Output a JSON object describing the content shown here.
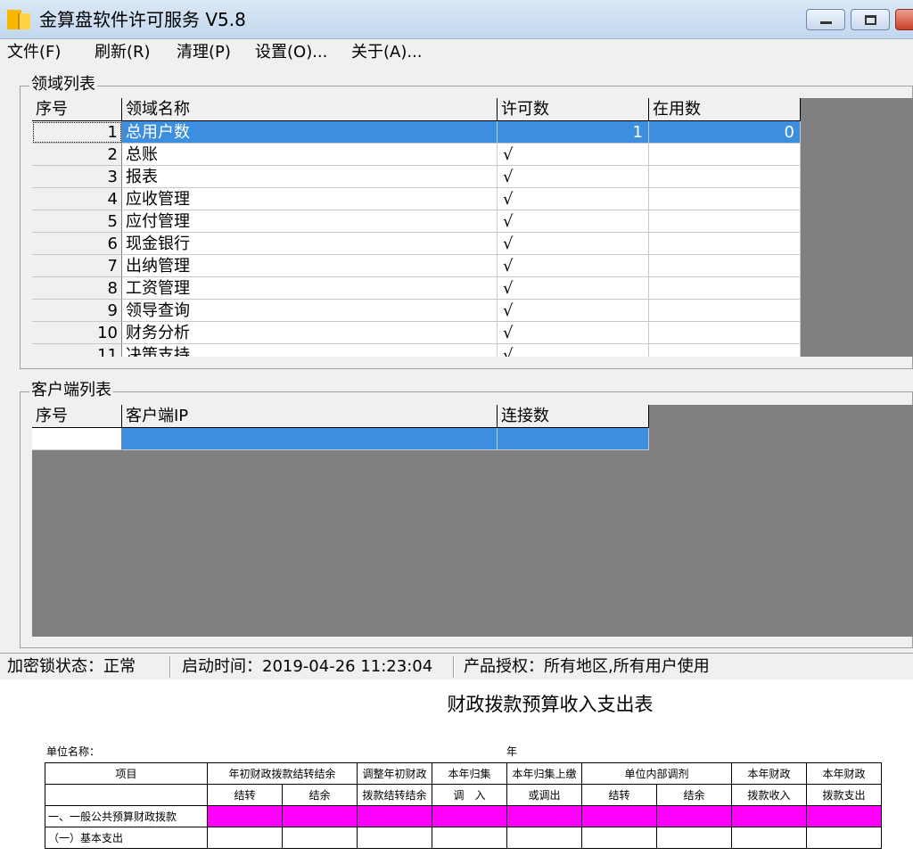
{
  "window": {
    "title": "金算盘软件许可服务 V5.8",
    "icon": "app-logo-icon"
  },
  "menu": [
    "文件(F)",
    "刷新(R)",
    "清理(P)",
    "设置(O)...",
    "关于(A)..."
  ],
  "domain_list": {
    "group_title": "领域列表",
    "headers": [
      "序号",
      "领域名称",
      "许可数",
      "在用数"
    ],
    "rows": [
      {
        "no": "1",
        "name": "总用户数",
        "license": "1",
        "in_use": "0"
      },
      {
        "no": "2",
        "name": "总账",
        "license": "√",
        "in_use": ""
      },
      {
        "no": "3",
        "name": "报表",
        "license": "√",
        "in_use": ""
      },
      {
        "no": "4",
        "name": "应收管理",
        "license": "√",
        "in_use": ""
      },
      {
        "no": "5",
        "name": "应付管理",
        "license": "√",
        "in_use": ""
      },
      {
        "no": "6",
        "name": "现金银行",
        "license": "√",
        "in_use": ""
      },
      {
        "no": "7",
        "name": "出纳管理",
        "license": "√",
        "in_use": ""
      },
      {
        "no": "8",
        "name": "工资管理",
        "license": "√",
        "in_use": ""
      },
      {
        "no": "9",
        "name": "领导查询",
        "license": "√",
        "in_use": ""
      },
      {
        "no": "10",
        "name": "财务分析",
        "license": "√",
        "in_use": ""
      },
      {
        "no": "11",
        "name": "决策支持",
        "license": "√",
        "in_use": ""
      }
    ],
    "selected_index": 0
  },
  "client_list": {
    "group_title": "客户端列表",
    "headers": [
      "序号",
      "客户端IP",
      "连接数"
    ]
  },
  "status": {
    "lock": "加密锁状态：正常",
    "start_time": "启动时间：2019-04-26 11:23:04",
    "license": "产品授权：所有地区,所有用户使用"
  },
  "document": {
    "title": "财政拨款预算收入支出表",
    "unit_label": "单位名称：",
    "year_label": "年",
    "header_row1": [
      "项目",
      "年初财政拨款结转结余",
      "调整年初财政",
      "本年归集",
      "本年归集上缴",
      "单位内部调剂",
      "本年财政",
      "本年财政"
    ],
    "header_row2": [
      "结转",
      "结余",
      "拨款结转结余",
      "调　入",
      "或调出",
      "结转",
      "结余",
      "拨款收入",
      "拨款支出"
    ],
    "rows": [
      "一、一般公共预算财政拨款",
      "（一）基本支出"
    ]
  },
  "colors": {
    "selection": "#3c8ede",
    "grid_background": "#808080",
    "highlight_row": "#ff00ff"
  }
}
